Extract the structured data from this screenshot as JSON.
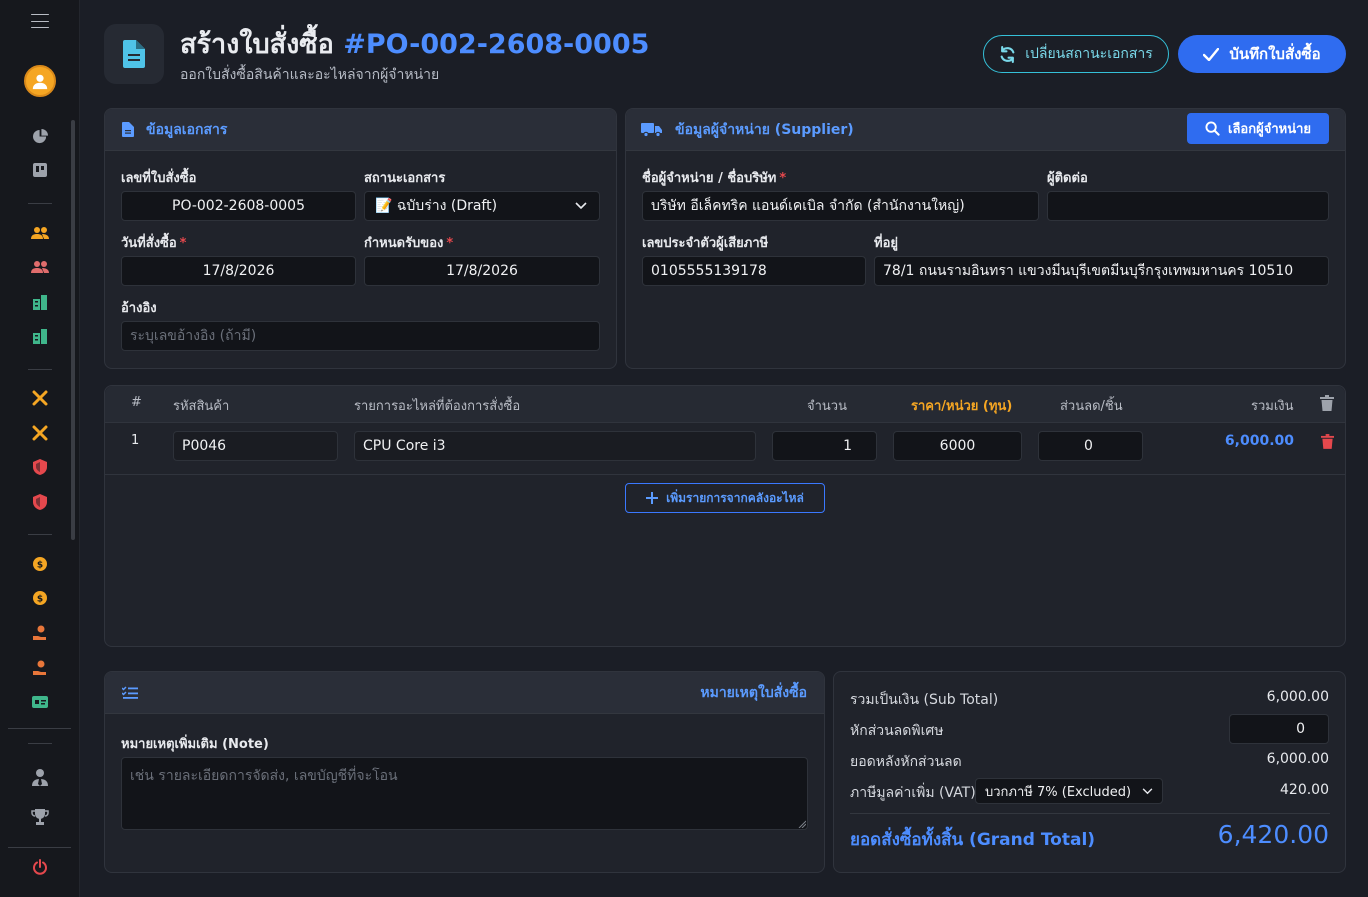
{
  "colors": {
    "accent": "#2f6cf0",
    "link_blue": "#4d8dff",
    "orange": "#f5a623",
    "danger": "#e5484d",
    "teal": "#35c0d8"
  },
  "sidebar": {
    "icons": [
      "menu-icon",
      "user-avatar",
      "chart-pie-icon",
      "kanban-icon",
      "users-icon",
      "users-icon",
      "building-icon",
      "building-icon",
      "tools-icon",
      "tools-icon",
      "shield-icon",
      "shield-icon",
      "coin-icon",
      "coin-icon",
      "hand-coin-icon",
      "hand-coin-icon",
      "id-card-icon",
      "user-tie-icon",
      "trophy-icon",
      "power-icon"
    ]
  },
  "header": {
    "title": "สร้างใบสั่งซื้อ",
    "po_number": "#PO-002-2608-0005",
    "subtitle": "ออกใบสั่งซื้อสินค้าและอะไหล่จากผู้จำหน่าย",
    "change_status_label": "เปลี่ยนสถานะเอกสาร",
    "save_label": "บันทึกใบสั่งซื้อ"
  },
  "document_info": {
    "title": "ข้อมูลเอกสาร",
    "po_number_label": "เลขที่ใบสั่งซื้อ",
    "po_number_value": "PO-002-2608-0005",
    "status_label": "สถานะเอกสาร",
    "status_value": "📝 ฉบับร่าง (Draft)",
    "order_date_label": "วันที่สั่งซื้อ",
    "order_date_value": "17/8/2026",
    "due_date_label": "กำหนดรับของ",
    "due_date_value": "17/8/2026",
    "reference_label": "อ้างอิง",
    "reference_placeholder": "ระบุเลขอ้างอิง (ถ้ามี)"
  },
  "supplier_info": {
    "title": "ข้อมูลผู้จำหน่าย (Supplier)",
    "choose_button": "เลือกผู้จำหน่าย",
    "name_label": "ชื่อผู้จำหน่าย / ชื่อบริษัท",
    "name_value": "บริษัท อีเล็คทริค แอนด์เคเบิล จำกัด (สำนักงานใหญ่)",
    "contact_label": "ผู้ติดต่อ",
    "contact_value": "",
    "tax_id_label": "เลขประจำตัวผู้เสียภาษี",
    "tax_id_value": "0105555139178",
    "address_label": "ที่อยู่",
    "address_value": "78/1 ถนนรามอินทรา แขวงมีนบุรีเขตมีนบุรีกรุงเทพมหานคร 10510"
  },
  "items": {
    "headers": {
      "index": "#",
      "code": "รหัสสินค้า",
      "description": "รายการอะไหล่ที่ต้องการสั่งซื้อ",
      "qty": "จำนวน",
      "unit_price": "ราคา/หน่วย (ทุน)",
      "discount": "ส่วนลด/ชิ้น",
      "total": "รวมเงิน"
    },
    "rows": [
      {
        "index": "1",
        "code": "P0046",
        "description": "CPU Core i3",
        "qty": "1",
        "unit_price": "6000",
        "discount": "0",
        "total": "6,000.00"
      }
    ],
    "add_button": "เพิ่มรายการจากคลังอะไหล่"
  },
  "notes": {
    "title": "หมายเหตุใบสั่งซื้อ",
    "note_label": "หมายเหตุเพิ่มเติม (Note)",
    "note_placeholder": "เช่น รายละเอียดการจัดส่ง, เลขบัญชีที่จะโอน"
  },
  "totals": {
    "subtotal_label": "รวมเป็นเงิน (Sub Total)",
    "subtotal_value": "6,000.00",
    "special_discount_label": "หักส่วนลดพิเศษ",
    "special_discount_value": "0",
    "after_discount_label": "ยอดหลังหักส่วนลด",
    "after_discount_value": "6,000.00",
    "vat_label": "ภาษีมูลค่าเพิ่ม (VAT)",
    "vat_option": "บวกภาษี 7% (Excluded)",
    "vat_value": "420.00",
    "grand_total_label": "ยอดสั่งซื้อทั้งสิ้น (Grand Total)",
    "grand_total_value": "6,420.00"
  }
}
